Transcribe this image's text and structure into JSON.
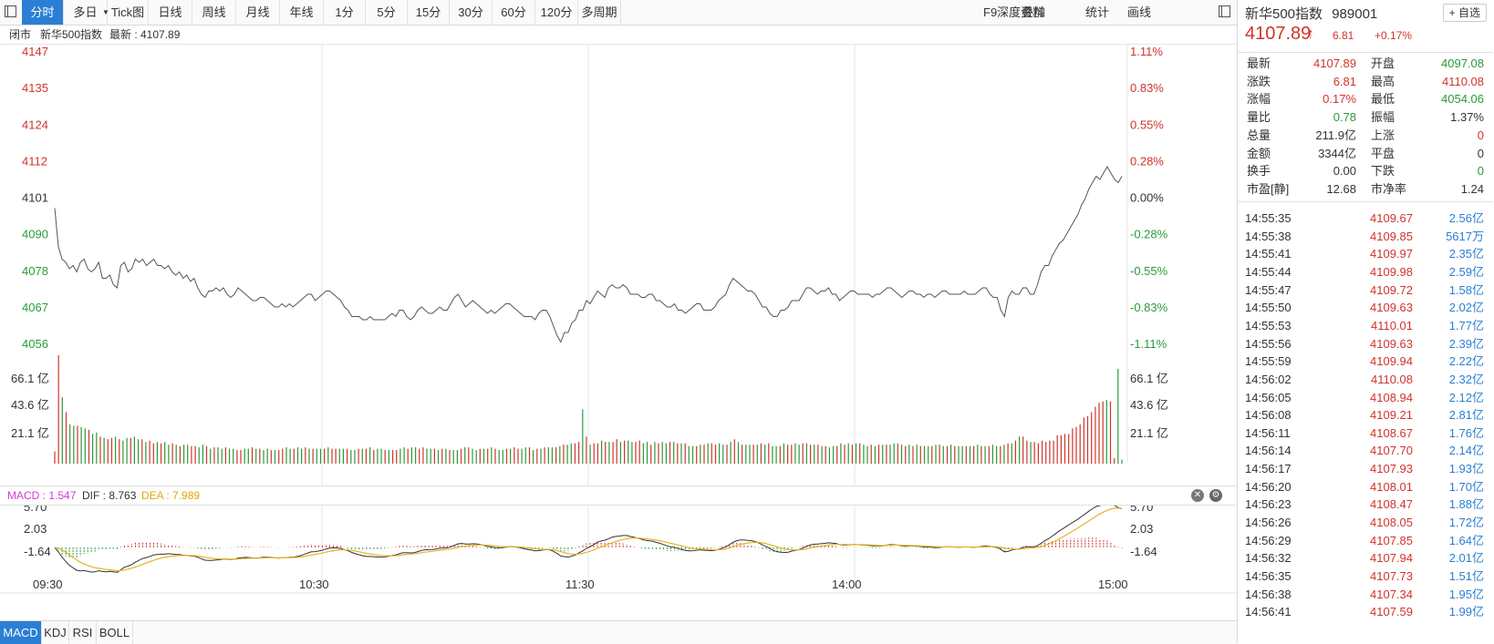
{
  "toolbar": {
    "tabs": [
      "分时",
      "多日",
      "Tick图",
      "日线",
      "周线",
      "月线",
      "年线",
      "1分",
      "5分",
      "15分",
      "30分",
      "60分",
      "120分",
      "多周期"
    ],
    "active": "分时",
    "right_items": [
      "F9深度资料",
      "叠加",
      "统计",
      "画线"
    ]
  },
  "status": {
    "state": "闭市",
    "name": "新华500指数",
    "latest_label": "最新 : 4107.89"
  },
  "chart_data": {
    "type": "line",
    "price_axis_left": [
      "4147",
      "4135",
      "4124",
      "4112",
      "4101",
      "4090",
      "4078",
      "4067",
      "4056"
    ],
    "price_axis_right": [
      "1.11%",
      "0.83%",
      "0.55%",
      "0.28%",
      "0.00%",
      "-0.28%",
      "-0.55%",
      "-0.83%",
      "-1.11%"
    ],
    "price_range": [
      4055,
      4147
    ],
    "prev_close": 4101.08,
    "price_series": [
      4098,
      4086,
      4082,
      4081,
      4079,
      4080,
      4078,
      4081,
      4082,
      4079,
      4078,
      4079,
      4081,
      4076,
      4076,
      4077,
      4074,
      4073,
      4080,
      4081,
      4078,
      4079,
      4082,
      4081,
      4082,
      4080,
      4081,
      4082,
      4080,
      4080,
      4079,
      4080,
      4078,
      4077,
      4078,
      4076,
      4077,
      4075,
      4076,
      4073,
      4071,
      4070,
      4072,
      4072,
      4073,
      4072,
      4073,
      4071,
      4070,
      4071,
      4073,
      4072,
      4071,
      4070,
      4069,
      4069,
      4070,
      4070,
      4069,
      4068,
      4067,
      4067,
      4068,
      4067,
      4068,
      4067,
      4068,
      4069,
      4070,
      4071,
      4071,
      4069,
      4070,
      4071,
      4072,
      4072,
      4071,
      4070,
      4069,
      4067,
      4066,
      4064,
      4064,
      4064,
      4063,
      4063,
      4064,
      4063,
      4063,
      4063,
      4063,
      4064,
      4065,
      4064,
      4066,
      4066,
      4064,
      4063,
      4064,
      4066,
      4067,
      4066,
      4065,
      4065,
      4066,
      4067,
      4066,
      4066,
      4068,
      4070,
      4071,
      4069,
      4067,
      4068,
      4069,
      4068,
      4067,
      4066,
      4065,
      4066,
      4065,
      4066,
      4067,
      4068,
      4068,
      4067,
      4066,
      4065,
      4064,
      4064,
      4064,
      4063,
      4065,
      4066,
      4066,
      4064,
      4061,
      4058,
      4056,
      4059,
      4059,
      4062,
      4063,
      4066,
      4066,
      4069,
      4068,
      4070,
      4072,
      4071,
      4070,
      4073,
      4074,
      4073,
      4073,
      4074,
      4073,
      4071,
      4071,
      4071,
      4070,
      4070,
      4071,
      4071,
      4069,
      4069,
      4068,
      4067,
      4067,
      4068,
      4066,
      4066,
      4065,
      4066,
      4067,
      4068,
      4068,
      4066,
      4066,
      4066,
      4067,
      4069,
      4070,
      4071,
      4074,
      4076,
      4075,
      4074,
      4073,
      4072,
      4072,
      4071,
      4069,
      4067,
      4067,
      4065,
      4064,
      4064,
      4066,
      4066,
      4067,
      4069,
      4069,
      4069,
      4071,
      4073,
      4073,
      4072,
      4071,
      4072,
      4072,
      4073,
      4071,
      4071,
      4069,
      4070,
      4071,
      4072,
      4072,
      4071,
      4071,
      4071,
      4071,
      4070,
      4071,
      4071,
      4072,
      4073,
      4073,
      4072,
      4071,
      4070,
      4071,
      4072,
      4072,
      4071,
      4071,
      4070,
      4071,
      4071,
      4070,
      4071,
      4072,
      4072,
      4071,
      4071,
      4071,
      4071,
      4072,
      4071,
      4071,
      4071,
      4072,
      4073,
      4073,
      4071,
      4070,
      4070,
      4066,
      4064,
      4070,
      4072,
      4071,
      4071,
      4073,
      4073,
      4071,
      4071,
      4074,
      4078,
      4080,
      4080,
      4083,
      4085,
      4087,
      4088,
      4090,
      4092,
      4094,
      4096,
      4099,
      4101,
      4104,
      4106,
      4108,
      4107,
      4109,
      4111,
      4109,
      4107,
      4106,
      4108
    ],
    "time_labels": [
      "09:30",
      "10:30",
      "11:30",
      "14:00",
      "15:00"
    ],
    "volume_axis": [
      "66.1 亿",
      "43.6 亿",
      "21.1 亿"
    ],
    "volume_max": 80,
    "volume_series": [
      9,
      80,
      49,
      38,
      29,
      28,
      28,
      27,
      26,
      25,
      22,
      23,
      20,
      19,
      18,
      19,
      20,
      18,
      17,
      19,
      19,
      20,
      18,
      18,
      16,
      17,
      15,
      16,
      15,
      16,
      14,
      15,
      14,
      13,
      14,
      14,
      13,
      13,
      12,
      14,
      13,
      11,
      12,
      12,
      11,
      12,
      11,
      11,
      10,
      10,
      11,
      11,
      12,
      11,
      11,
      10,
      11,
      10,
      10,
      10,
      11,
      12,
      11,
      11,
      12,
      11,
      12,
      11,
      11,
      11,
      11,
      11,
      12,
      11,
      11,
      11,
      11,
      11,
      10,
      10,
      11,
      11,
      11,
      12,
      10,
      11,
      11,
      10,
      10,
      10,
      10,
      11,
      12,
      11,
      12,
      12,
      11,
      12,
      11,
      11,
      11,
      10,
      11,
      11,
      10,
      10,
      10,
      11,
      12,
      12,
      11,
      10,
      11,
      11,
      11,
      12,
      11,
      10,
      10,
      11,
      11,
      12,
      11,
      11,
      12,
      12,
      10,
      11,
      11,
      12,
      12,
      12,
      12,
      13,
      14,
      14,
      15,
      15,
      16,
      40,
      20,
      14,
      15,
      15,
      17,
      16,
      16,
      16,
      18,
      16,
      17,
      17,
      16,
      16,
      17,
      15,
      16,
      14,
      16,
      15,
      16,
      15,
      16,
      16,
      15,
      15,
      15,
      13,
      13,
      13,
      14,
      14,
      15,
      15,
      14,
      15,
      14,
      14,
      16,
      18,
      16,
      14,
      14,
      14,
      14,
      14,
      15,
      14,
      15,
      13,
      13,
      13,
      15,
      14,
      14,
      15,
      14,
      15,
      15,
      14,
      14,
      14,
      13,
      13,
      12,
      13,
      13,
      15,
      14,
      15,
      14,
      15,
      15,
      14,
      13,
      14,
      13,
      14,
      14,
      14,
      14,
      15,
      15,
      14,
      13,
      14,
      13,
      14,
      13,
      13,
      13,
      13,
      14,
      14,
      13,
      13,
      14,
      13,
      13,
      13,
      13,
      13,
      13,
      14,
      13,
      13,
      13,
      14,
      13,
      13,
      14,
      15,
      15,
      17,
      20,
      20,
      17,
      16,
      16,
      15,
      17,
      16,
      17,
      17,
      21,
      21,
      22,
      22,
      26,
      27,
      29,
      34,
      35,
      38,
      42,
      45,
      46,
      47,
      46,
      4,
      70,
      3
    ],
    "volume_up": [
      1,
      1,
      0,
      1,
      0,
      0,
      1,
      0,
      0,
      1,
      0,
      0,
      1,
      0,
      1,
      1,
      0,
      1,
      0,
      0,
      1,
      0,
      0,
      1,
      0,
      1,
      1,
      0,
      1,
      0,
      0,
      1,
      0,
      1,
      0,
      0,
      1,
      1,
      0,
      0,
      1,
      0,
      1,
      0,
      0,
      1,
      0,
      0,
      1,
      1,
      0,
      0,
      1,
      0,
      1,
      0,
      0,
      1,
      0,
      1,
      1,
      0,
      0,
      1,
      0,
      0,
      1,
      0,
      1,
      0,
      0,
      1,
      0,
      1,
      1,
      0,
      0,
      1,
      0,
      0,
      1,
      0,
      1,
      0,
      1,
      0,
      0,
      1,
      0,
      1,
      1,
      0,
      0,
      1,
      0,
      0,
      1,
      1,
      0,
      0,
      1,
      0,
      1,
      0,
      1,
      0,
      0,
      1,
      0,
      1,
      0,
      0,
      1,
      0,
      1,
      0,
      1,
      0,
      0,
      1,
      0,
      1,
      1,
      0,
      0,
      1,
      0,
      1,
      0,
      1,
      0,
      0,
      1,
      0,
      1,
      0,
      0,
      1,
      1,
      0,
      1,
      0,
      1,
      1,
      0,
      1,
      0,
      1,
      1,
      0,
      1,
      0,
      0,
      1,
      1,
      0,
      0,
      1,
      0,
      1,
      0,
      0,
      1,
      0,
      1,
      0,
      1,
      0,
      0,
      1,
      0,
      1,
      0,
      1,
      1,
      0,
      0,
      1,
      0,
      1,
      0,
      1,
      0,
      0,
      1,
      0,
      1,
      0,
      1,
      0,
      0,
      1,
      0,
      1,
      1,
      0,
      0,
      1,
      0,
      1,
      0,
      1,
      0,
      1,
      0,
      0,
      1,
      0,
      1,
      0,
      1,
      0,
      1,
      0,
      0,
      1,
      0,
      1,
      0,
      1,
      0,
      0,
      1,
      0,
      1,
      0,
      1,
      0,
      1,
      0,
      0,
      1,
      0,
      1,
      0,
      1,
      0,
      1,
      0,
      0,
      1,
      0,
      1,
      0,
      1,
      0,
      1,
      0,
      0,
      1,
      0,
      1,
      0,
      1,
      0,
      1,
      1,
      0,
      1,
      1,
      1,
      1,
      1,
      1,
      1,
      1,
      1,
      1,
      1,
      1,
      1,
      1,
      1,
      1,
      1,
      1,
      1,
      0,
      1,
      1
    ],
    "macd_axis": [
      "5.70",
      "2.03",
      "-1.64"
    ],
    "macd_range": [
      -5.5,
      8.5
    ],
    "macd_label": "MACD : 1.547",
    "dif_label": "DIF : 8.763",
    "dea_label": "DEA : 7.989"
  },
  "indicator_tabs": [
    "MACD",
    "KDJ",
    "RSI",
    "BOLL"
  ],
  "right_panel": {
    "name": "新华500指数",
    "code": "989001",
    "watch": "+ 自选",
    "price": "4107.89",
    "arrow": "↑",
    "change": "6.81",
    "change_pct": "+0.17%",
    "stats": [
      {
        "l1": "最新",
        "v1": "4107.89",
        "c1": "red",
        "l2": "开盘",
        "v2": "4097.08",
        "c2": "green"
      },
      {
        "l1": "涨跌",
        "v1": "6.81",
        "c1": "red",
        "l2": "最高",
        "v2": "4110.08",
        "c2": "red"
      },
      {
        "l1": "涨幅",
        "v1": "0.17%",
        "c1": "red",
        "l2": "最低",
        "v2": "4054.06",
        "c2": "green"
      },
      {
        "l1": "量比",
        "v1": "0.78",
        "c1": "green",
        "l2": "振幅",
        "v2": "1.37%",
        "c2": "dark"
      },
      {
        "l1": "总量",
        "v1": "211.9亿",
        "c1": "dark",
        "l2": "上涨",
        "v2": "0",
        "c2": "red"
      },
      {
        "l1": "金额",
        "v1": "3344亿",
        "c1": "dark",
        "l2": "平盘",
        "v2": "0",
        "c2": "dark"
      },
      {
        "l1": "换手",
        "v1": "0.00",
        "c1": "dark",
        "l2": "下跌",
        "v2": "0",
        "c2": "green"
      },
      {
        "l1": "市盈[静]",
        "v1": "12.68",
        "c1": "dark",
        "l2": "市净率",
        "v2": "1.24",
        "c2": "dark"
      }
    ],
    "ticks": [
      {
        "t": "14:55:35",
        "p": "4109.67",
        "v": "2.56亿"
      },
      {
        "t": "14:55:38",
        "p": "4109.85",
        "v": "5617万"
      },
      {
        "t": "14:55:41",
        "p": "4109.97",
        "v": "2.35亿"
      },
      {
        "t": "14:55:44",
        "p": "4109.98",
        "v": "2.59亿"
      },
      {
        "t": "14:55:47",
        "p": "4109.72",
        "v": "1.58亿"
      },
      {
        "t": "14:55:50",
        "p": "4109.63",
        "v": "2.02亿"
      },
      {
        "t": "14:55:53",
        "p": "4110.01",
        "v": "1.77亿"
      },
      {
        "t": "14:55:56",
        "p": "4109.63",
        "v": "2.39亿"
      },
      {
        "t": "14:55:59",
        "p": "4109.94",
        "v": "2.22亿"
      },
      {
        "t": "14:56:02",
        "p": "4110.08",
        "v": "2.32亿"
      },
      {
        "t": "14:56:05",
        "p": "4108.94",
        "v": "2.12亿"
      },
      {
        "t": "14:56:08",
        "p": "4109.21",
        "v": "2.81亿"
      },
      {
        "t": "14:56:11",
        "p": "4108.67",
        "v": "1.76亿"
      },
      {
        "t": "14:56:14",
        "p": "4107.70",
        "v": "2.14亿"
      },
      {
        "t": "14:56:17",
        "p": "4107.93",
        "v": "1.93亿"
      },
      {
        "t": "14:56:20",
        "p": "4108.01",
        "v": "1.70亿"
      },
      {
        "t": "14:56:23",
        "p": "4108.47",
        "v": "1.88亿"
      },
      {
        "t": "14:56:26",
        "p": "4108.05",
        "v": "1.72亿"
      },
      {
        "t": "14:56:29",
        "p": "4107.85",
        "v": "1.64亿"
      },
      {
        "t": "14:56:32",
        "p": "4107.94",
        "v": "2.01亿"
      },
      {
        "t": "14:56:35",
        "p": "4107.73",
        "v": "1.51亿"
      },
      {
        "t": "14:56:38",
        "p": "4107.34",
        "v": "1.95亿"
      },
      {
        "t": "14:56:41",
        "p": "4107.59",
        "v": "1.99亿"
      }
    ]
  },
  "colors": {
    "up": "#d0342c",
    "down": "#2a9a3a",
    "accent": "#2a7fd4",
    "dif": "#333333",
    "dea": "#e6b422",
    "macd_label": "#d23bd2"
  }
}
